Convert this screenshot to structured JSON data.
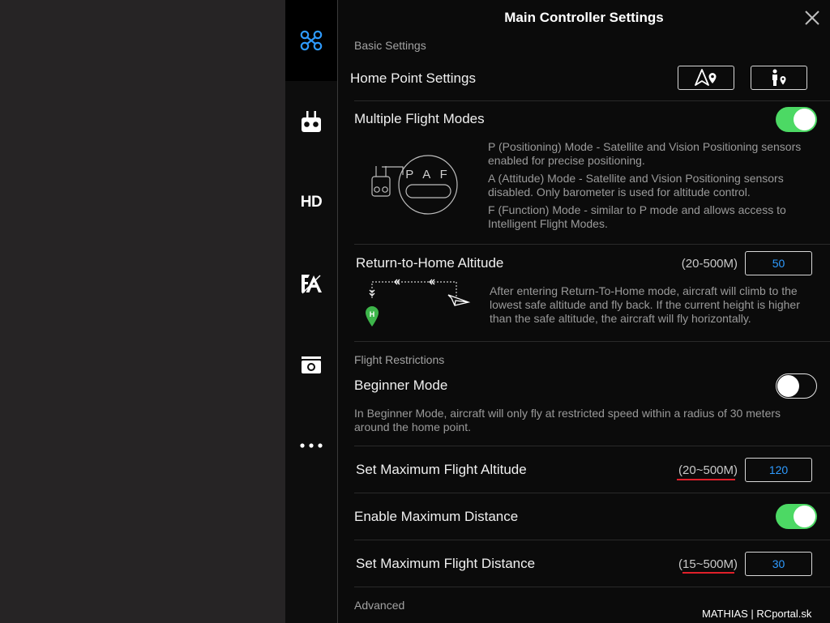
{
  "header": {
    "title": "Main Controller Settings"
  },
  "sidebar": {
    "tabs": [
      {
        "name": "aircraft",
        "icon": "drone-icon",
        "active": true
      },
      {
        "name": "remote-controller",
        "icon": "remote-controller-icon"
      },
      {
        "name": "hd-transmission",
        "icon": "hd-icon",
        "label": "HD"
      },
      {
        "name": "calibration",
        "icon": "compass-icon"
      },
      {
        "name": "camera",
        "icon": "camera-icon"
      },
      {
        "name": "more",
        "icon": "more-icon"
      }
    ]
  },
  "basic_settings": {
    "section_label": "Basic Settings",
    "home_point": {
      "label": "Home Point Settings",
      "buttons": [
        "aircraft-location-icon",
        "person-location-icon"
      ]
    },
    "multiple_flight_modes": {
      "label": "Multiple Flight Modes",
      "enabled": true,
      "switch_letters": "P A F",
      "descriptions": [
        "P (Positioning) Mode - Satellite and Vision Positioning sensors enabled for precise positioning.",
        "A (Attitude) Mode - Satellite and Vision Positioning sensors disabled. Only barometer is used for altitude control.",
        "F (Function) Mode - similar to P mode and allows access to Intelligent Flight Modes."
      ]
    },
    "rth_altitude": {
      "label": "Return-to-Home Altitude",
      "range": "(20-500M)",
      "value": "50",
      "home_marker": "H",
      "description": "After entering Return-To-Home mode, aircraft will climb to the lowest safe altitude and fly back. If the current height is higher than the safe altitude, the aircraft will fly horizontally."
    }
  },
  "flight_restrictions": {
    "section_label": "Flight Restrictions",
    "beginner_mode": {
      "label": "Beginner Mode",
      "enabled": false,
      "description": "In Beginner Mode, aircraft will only fly at restricted speed within a radius of 30 meters around the home point."
    },
    "max_altitude": {
      "label": "Set Maximum Flight Altitude",
      "range": "(20~500M)",
      "value": "120"
    },
    "enable_max_distance": {
      "label": "Enable Maximum Distance",
      "enabled": true
    },
    "max_distance": {
      "label": "Set Maximum Flight Distance",
      "range": "(15~500M)",
      "value": "30"
    }
  },
  "advanced": {
    "section_label": "Advanced"
  },
  "watermark": "MATHIAS | RCportal.sk",
  "colors": {
    "accent": "#2e9bff",
    "toggle_on": "#4cd964",
    "annotation": "#e0202a",
    "home_marker": "#3db54a"
  }
}
